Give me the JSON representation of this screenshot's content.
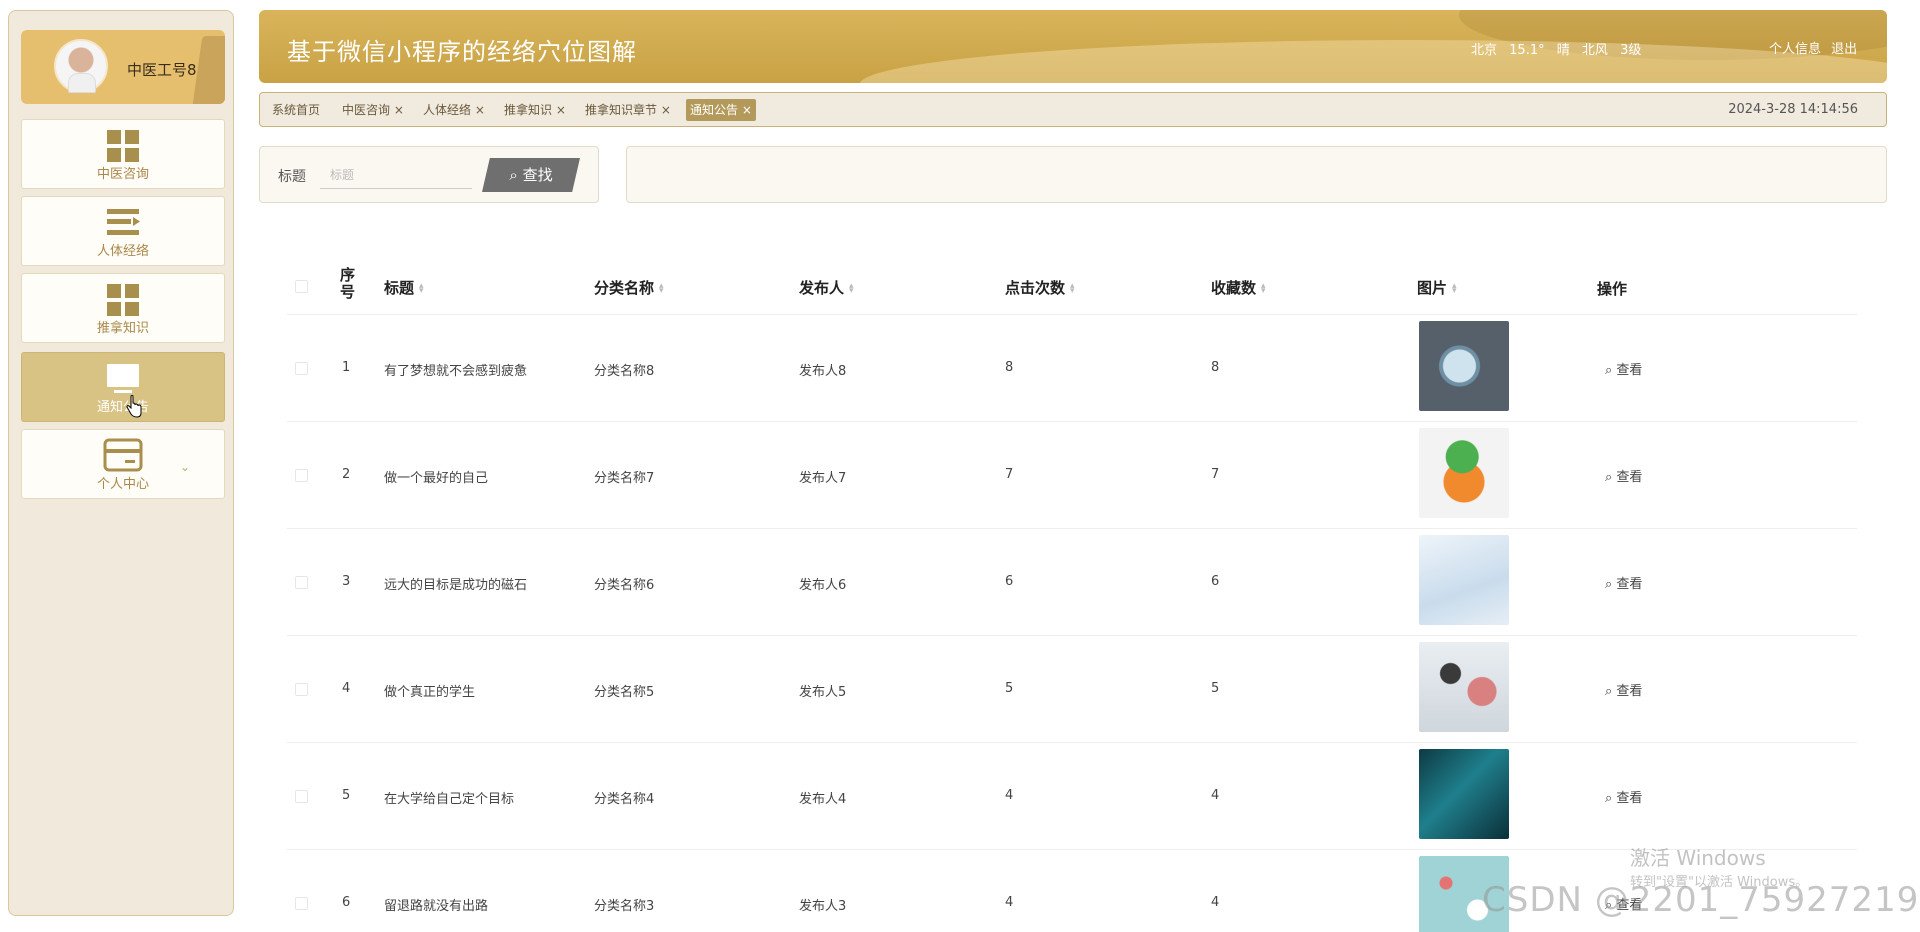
{
  "sidebar": {
    "user_name": "中医工号8",
    "items": [
      {
        "label": "中医咨询",
        "icon": "grid-icon"
      },
      {
        "label": "人体经络",
        "icon": "list-icon"
      },
      {
        "label": "推拿知识",
        "icon": "grid-icon"
      },
      {
        "label": "通知公告",
        "icon": "monitor-icon"
      },
      {
        "label": "个人中心",
        "icon": "card-icon"
      }
    ]
  },
  "header": {
    "title": "基于微信小程序的经络穴位图解",
    "weather": {
      "city": "北京",
      "temp": "15.1°",
      "condition": "晴",
      "wind": "北风",
      "level": "3级"
    },
    "links": [
      "个人信息",
      "退出"
    ]
  },
  "tabs": [
    {
      "label": "系统首页"
    },
    {
      "label": "中医咨询 ×"
    },
    {
      "label": "人体经络 ×"
    },
    {
      "label": "推拿知识 ×"
    },
    {
      "label": "推拿知识章节 ×"
    },
    {
      "label": "通知公告 ×"
    }
  ],
  "datetime": "2024-3-28 14:14:56",
  "search": {
    "label": "标题",
    "placeholder": "标题",
    "button": "查找"
  },
  "table": {
    "headers": [
      "序号",
      "标题",
      "分类名称",
      "发布人",
      "点击次数",
      "收藏数",
      "图片",
      "操作"
    ],
    "rows": [
      {
        "no": "1",
        "title": "有了梦想就不会感到疲惫",
        "category": "分类名称8",
        "publisher": "发布人8",
        "clicks": "8",
        "favorites": "8"
      },
      {
        "no": "2",
        "title": "做一个最好的自己",
        "category": "分类名称7",
        "publisher": "发布人7",
        "clicks": "7",
        "favorites": "7"
      },
      {
        "no": "3",
        "title": "远大的目标是成功的磁石",
        "category": "分类名称6",
        "publisher": "发布人6",
        "clicks": "6",
        "favorites": "6"
      },
      {
        "no": "4",
        "title": "做个真正的学生",
        "category": "分类名称5",
        "publisher": "发布人5",
        "clicks": "5",
        "favorites": "5"
      },
      {
        "no": "5",
        "title": "在大学给自己定个目标",
        "category": "分类名称4",
        "publisher": "发布人4",
        "clicks": "4",
        "favorites": "4"
      },
      {
        "no": "6",
        "title": "留退路就没有出路",
        "category": "分类名称3",
        "publisher": "发布人3",
        "clicks": "4",
        "favorites": "4"
      }
    ],
    "action_label": "查看"
  },
  "watermark": {
    "line1": "激活 Windows",
    "line2": "转到\"设置\"以激活 Windows。",
    "csdn": "CSDN @2201_75927219"
  },
  "colors": {
    "accent": "#d9b45a",
    "active_tab": "#b49a5a",
    "sidebar_bg": "#f1e9dc"
  }
}
